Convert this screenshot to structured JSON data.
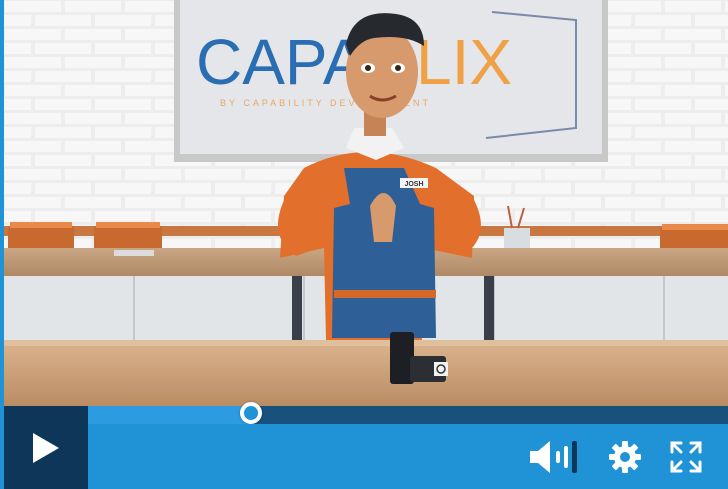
{
  "video": {
    "logo_text_dark": "CAPA",
    "logo_text_orange": "LIX",
    "logo_tagline": "BY CAPABILITY DEVELOPMENT",
    "name_tag": "JOSH"
  },
  "player": {
    "progress": 0.255,
    "volume_level": "high"
  },
  "icons": {
    "play": "play-icon",
    "volume": "volume-icon",
    "settings": "gear-icon",
    "fullscreen": "fullscreen-icon"
  },
  "colors": {
    "bar_blue": "#1f93d6",
    "track_dark": "#17517c",
    "play_bg": "#0d3658",
    "logo_blue": "#2a6db3",
    "logo_orange": "#f0a045",
    "shirt_orange": "#e26f2b",
    "apron_blue": "#2e5f97"
  }
}
